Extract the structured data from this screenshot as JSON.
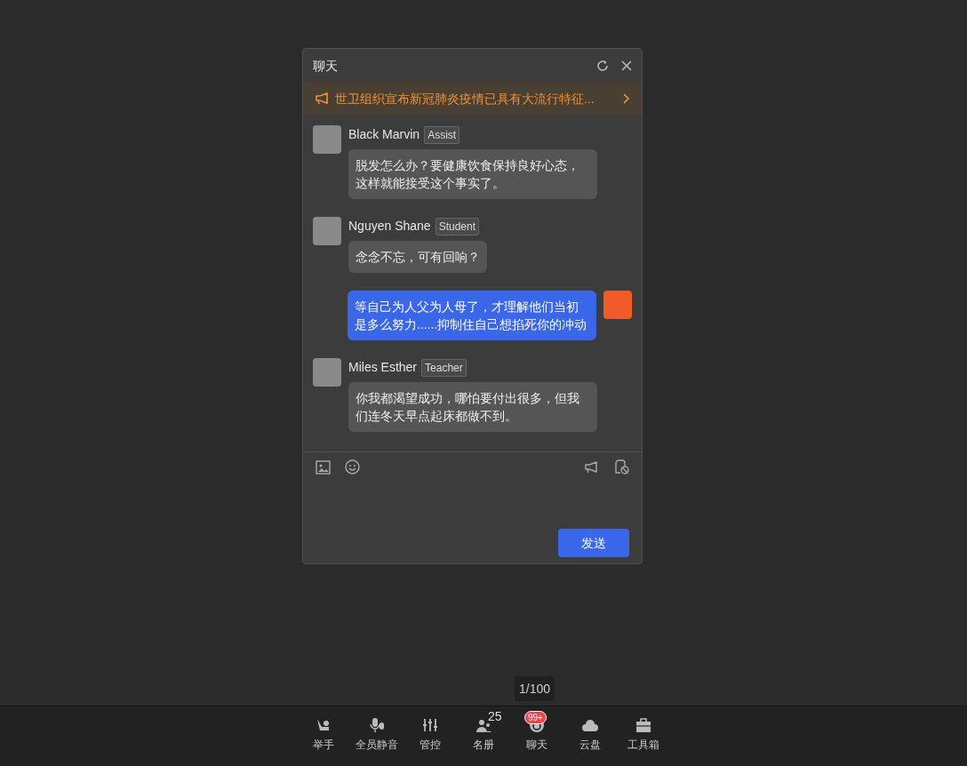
{
  "chat_window": {
    "title": "聊天",
    "announcement": "世卫组织宣布新冠肺炎疫情已具有大流行特征...",
    "messages": [
      {
        "kind": "received",
        "sender": "Black Marvin",
        "role": "Assist",
        "text": "脱发怎么办？要健康饮食保持良好心态，这样就能接受这个事实了。"
      },
      {
        "kind": "received",
        "sender": "Nguyen Shane",
        "role": "Student",
        "text": "念念不忘，可有回响？"
      },
      {
        "kind": "sent",
        "text": "等自己为人父为人母了，才理解他们当初是多么努力......抑制住自己想掐死你的冲动"
      },
      {
        "kind": "received",
        "sender": "Miles Esther",
        "role": "Teacher",
        "text": "你我都渴望成功，哪怕要付出很多，但我们连冬天早点起床都做不到。"
      }
    ],
    "send_button": "发送"
  },
  "page_indicator": "1/100",
  "toolbar": [
    {
      "kind": "hand",
      "label": "举手"
    },
    {
      "kind": "mics",
      "label": "全员静音"
    },
    {
      "kind": "sliders",
      "label": "管控"
    },
    {
      "kind": "people",
      "label": "名册",
      "count": "25"
    },
    {
      "kind": "chat",
      "label": "聊天",
      "badge": "99+"
    },
    {
      "kind": "cloud",
      "label": "云盘"
    },
    {
      "kind": "toolbox",
      "label": "工具箱"
    }
  ]
}
